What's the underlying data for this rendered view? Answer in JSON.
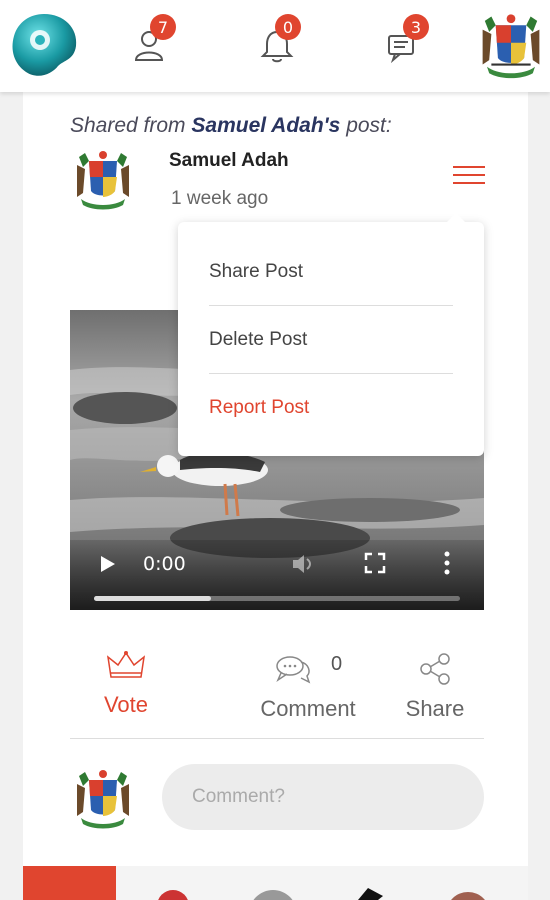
{
  "topbar": {
    "notifications": [
      {
        "icon": "users-icon",
        "count": "7"
      },
      {
        "icon": "bell-icon",
        "count": "0"
      },
      {
        "icon": "chat-icon",
        "count": "3"
      }
    ]
  },
  "post": {
    "shared_prefix": "Shared from",
    "shared_author": "Samuel Adah's",
    "shared_suffix": "post:",
    "author_name": "Samuel Adah",
    "time_ago": "1 week ago"
  },
  "menu": {
    "items": [
      {
        "label": "Share Post",
        "color": "#444444"
      },
      {
        "label": "Delete Post",
        "color": "#444444"
      },
      {
        "label": "Report Post",
        "color": "#e0452f"
      }
    ]
  },
  "video": {
    "current_time": "0:00",
    "progress": 0.32
  },
  "actions": {
    "vote_label": "Vote",
    "comment_count": "0",
    "comment_label": "Comment",
    "share_label": "Share"
  },
  "comment": {
    "placeholder": "Comment?"
  },
  "colors": {
    "accent": "#e0452f"
  }
}
